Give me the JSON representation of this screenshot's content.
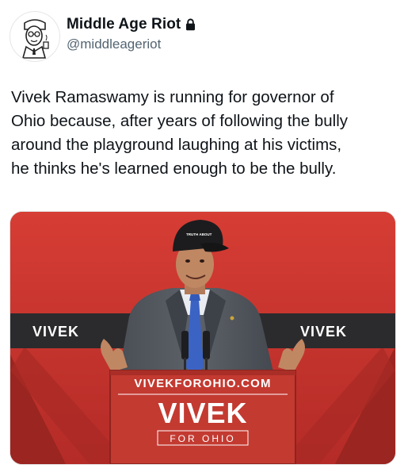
{
  "author": {
    "display_name": "Middle Age Riot",
    "handle": "@middleageriot",
    "avatar_icon": "cartoon-man-avatar",
    "protected_icon": "lock-icon"
  },
  "tweet": {
    "text": "Vivek Ramaswamy is running for governor of\nOhio because, after years of following the bully\naround the playground laughing at his victims,\nhe thinks he's learned enough to be the bully."
  },
  "media": {
    "banner_left": "VIVEK",
    "banner_right": "VIVEK",
    "podium_url": "VIVEKFOROHIO.COM",
    "podium_name": "VIVEK",
    "podium_tagline": "FOR OHIO",
    "colors": {
      "backdrop_red": "#c8322d",
      "banner_dark": "#2b2b2d",
      "podium_red": "#c33a31"
    }
  }
}
